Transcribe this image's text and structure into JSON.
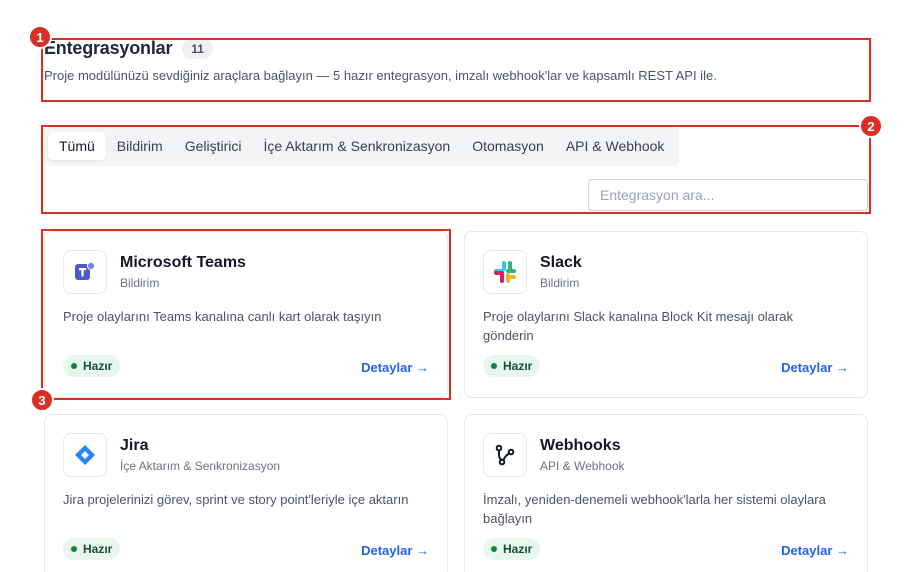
{
  "header": {
    "title": "Entegrasyonlar",
    "count": "11",
    "subtitle": "Proje modülünüzü sevdiğiniz araçlara bağlayın — 5 hazır entegrasyon, imzalı webhook'lar ve kapsamlı REST API ile."
  },
  "tabs": [
    "Tümü",
    "Bildirim",
    "Geliştirici",
    "İçe Aktarım & Senkronizasyon",
    "Otomasyon",
    "API & Webhook"
  ],
  "active_tab": "Tümü",
  "search": {
    "placeholder": "Entegrasyon ara..."
  },
  "cards": [
    {
      "name": "Microsoft Teams",
      "category": "Bildirim",
      "description": "Proje olaylarını Teams kanalına canlı kart olarak taşıyın",
      "status": "Hazır",
      "link": "Detaylar →",
      "icon": "microsoft-teams-icon"
    },
    {
      "name": "Slack",
      "category": "Bildirim",
      "description": "Proje olaylarını Slack kanalına Block Kit mesajı olarak gönderin",
      "status": "Hazır",
      "link": "Detaylar →",
      "icon": "slack-icon"
    },
    {
      "name": "Jira",
      "category": "İçe Aktarım & Senkronizasyon",
      "description": "Jira projelerinizi görev, sprint ve story point'leriyle içe aktarın",
      "status": "Hazır",
      "link": "Detaylar →",
      "icon": "jira-icon"
    },
    {
      "name": "Webhooks",
      "category": "API & Webhook",
      "description": "İmzalı, yeniden-denemeli webhook'larla her sistemi olaylara bağlayın",
      "status": "Hazır",
      "link": "Detaylar →",
      "icon": "webhooks-icon"
    }
  ],
  "annotations": [
    "1",
    "2",
    "3"
  ],
  "colors": {
    "accent": "#2563eb",
    "annotation": "#d93025",
    "ready_bg": "#e8f7ee",
    "ready_text": "#14532d"
  }
}
